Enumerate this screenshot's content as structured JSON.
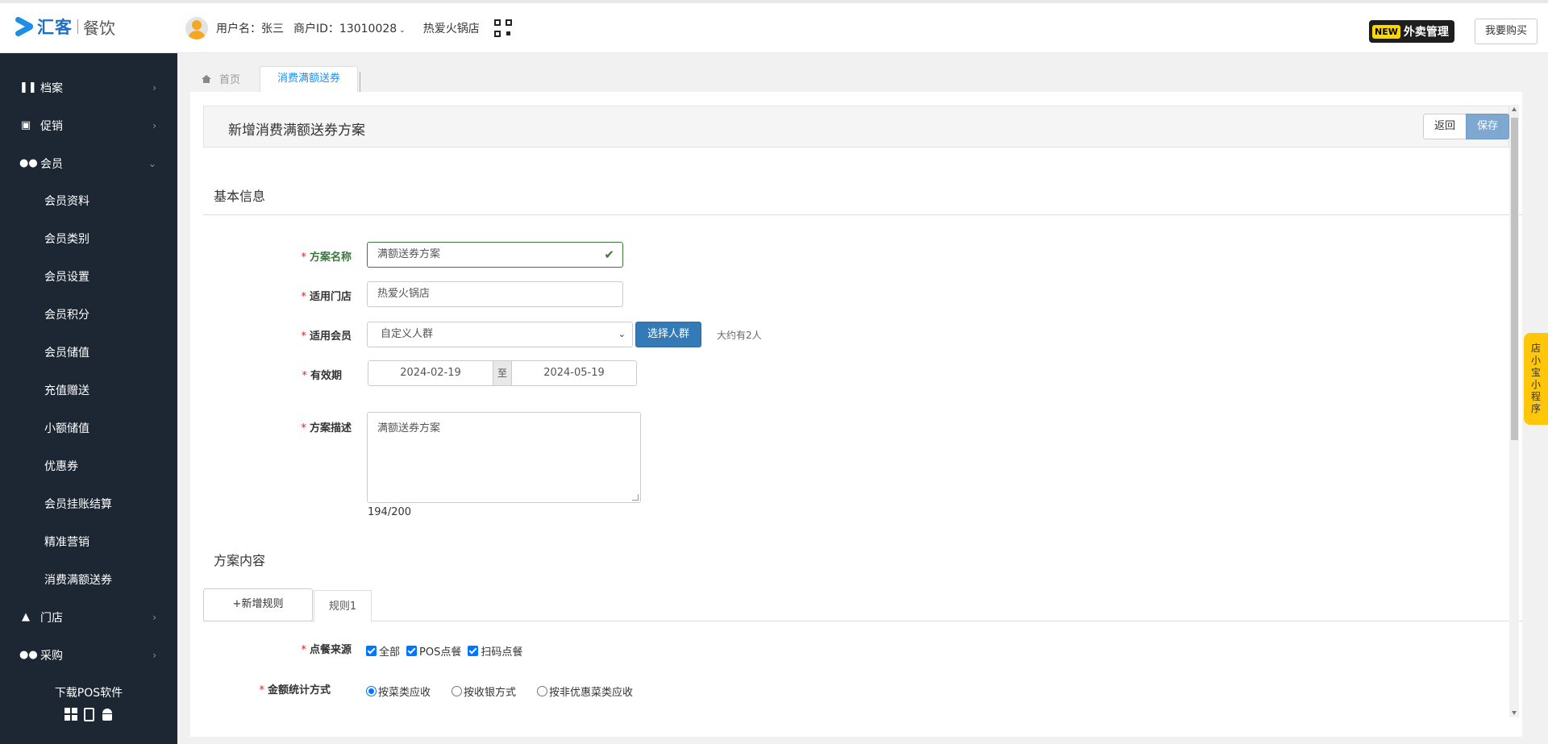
{
  "brand": {
    "name": "汇客",
    "sub": "餐饮"
  },
  "user": {
    "name_label": "用户名：张三",
    "merchant_label": "商户ID：13010028",
    "store": "热爱火锅店"
  },
  "header": {
    "new_badge": "NEW",
    "takeout_label": "外卖管理",
    "buy_label": "我要购买"
  },
  "sidebar": {
    "items": [
      {
        "label": "档案",
        "icon": "utensils-icon"
      },
      {
        "label": "促销",
        "icon": "gift-icon"
      },
      {
        "label": "会员",
        "icon": "users-icon"
      }
    ],
    "member_sub": [
      "会员资料",
      "会员类别",
      "会员设置",
      "会员积分",
      "会员储值",
      "充值赠送",
      "小额储值",
      "优惠券",
      "会员挂账结算",
      "精准营销",
      "消费满额送券"
    ],
    "bottom_items": [
      {
        "label": "门店",
        "icon": "bank-icon"
      },
      {
        "label": "采购",
        "icon": "users-icon"
      }
    ],
    "download_label": "下载POS软件"
  },
  "tabs": {
    "home": "首页",
    "active": "消费满额送券"
  },
  "page": {
    "title": "新增消费满额送券方案",
    "back_label": "返回",
    "save_label": "保存"
  },
  "basic": {
    "section_title": "基本信息",
    "name_label": "方案名称",
    "name_value": "满额送券方案",
    "store_label": "适用门店",
    "store_value": "热爱火锅店",
    "member_label": "适用会员",
    "member_value": "自定义人群",
    "crowd_button": "选择人群",
    "approx": "大约有2人",
    "period_label": "有效期",
    "date_start": "2024-02-19",
    "date_sep": "至",
    "date_end": "2024-05-19",
    "desc_label": "方案描述",
    "desc_value": "满额送券方案",
    "counter": "194/200"
  },
  "content": {
    "section_title": "方案内容",
    "add_rule": "+新增规则",
    "rule_tab": "规则1",
    "source_label": "点餐来源",
    "sources": [
      "全部",
      "POS点餐",
      "扫码点餐"
    ],
    "stat_label": "金额统计方式",
    "stat_options": [
      "按菜类应收",
      "按收银方式",
      "按非优惠菜类应收"
    ]
  },
  "float_tab": "店小宝小程序"
}
